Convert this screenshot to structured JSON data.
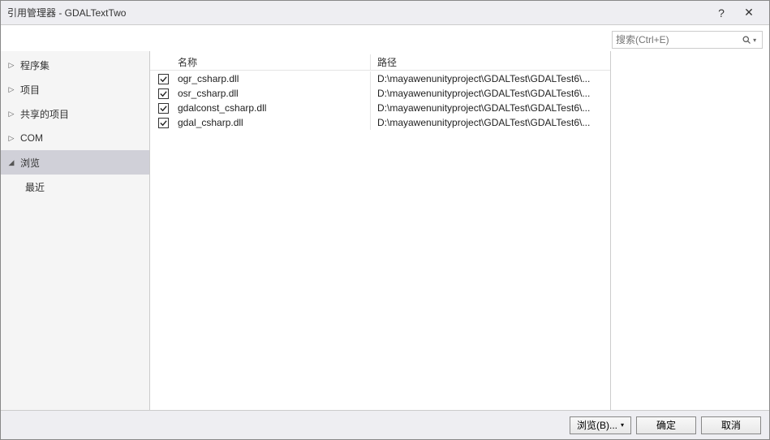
{
  "titlebar": {
    "title": "引用管理器 - GDALTextTwo",
    "help": "?",
    "close": "✕"
  },
  "search": {
    "placeholder": "搜索(Ctrl+E)"
  },
  "sidebar": {
    "items": [
      {
        "label": "程序集",
        "expanded": false
      },
      {
        "label": "项目",
        "expanded": false
      },
      {
        "label": "共享的项目",
        "expanded": false
      },
      {
        "label": "COM",
        "expanded": false
      },
      {
        "label": "浏览",
        "expanded": true,
        "selected": true
      }
    ],
    "sub": {
      "label": "最近"
    }
  },
  "list": {
    "headers": {
      "name": "名称",
      "path": "路径"
    },
    "rows": [
      {
        "checked": true,
        "name": "ogr_csharp.dll",
        "path": "D:\\mayawenunityproject\\GDALTest\\GDALTest6\\..."
      },
      {
        "checked": true,
        "name": "osr_csharp.dll",
        "path": "D:\\mayawenunityproject\\GDALTest\\GDALTest6\\..."
      },
      {
        "checked": true,
        "name": "gdalconst_csharp.dll",
        "path": "D:\\mayawenunityproject\\GDALTest\\GDALTest6\\..."
      },
      {
        "checked": true,
        "name": "gdal_csharp.dll",
        "path": "D:\\mayawenunityproject\\GDALTest\\GDALTest6\\..."
      }
    ]
  },
  "footer": {
    "browse": "浏览(B)...",
    "ok": "确定",
    "cancel": "取消"
  }
}
